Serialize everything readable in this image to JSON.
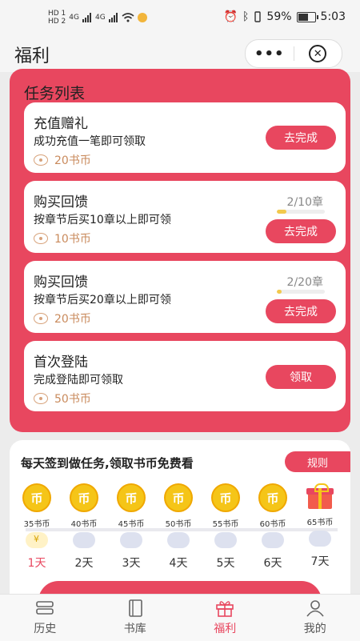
{
  "status_bar": {
    "sim1": "HD 1",
    "sim2": "HD 2",
    "net1": "4G",
    "net2": "4G",
    "battery": "59%",
    "time": "5:03"
  },
  "header": {
    "title": "福利",
    "menu_icon": "more-dots-icon",
    "close_icon": "close-circle-icon"
  },
  "tasks": {
    "title": "任务列表",
    "items": [
      {
        "name": "充值赠礼",
        "desc": "成功充值一笔即可领取",
        "reward": "20书币",
        "button": "去完成"
      },
      {
        "name": "购买回馈",
        "desc": "按章节后买10章以上即可领",
        "reward": "10书币",
        "progress_text": "2/10章",
        "progress": 0.2,
        "button": "去完成"
      },
      {
        "name": "购买回馈",
        "desc": "按章节后买20章以上即可领",
        "reward": "20书币",
        "progress_text": "2/20章",
        "progress": 0.1,
        "button": "去完成"
      },
      {
        "name": "首次登陆",
        "desc": "完成登陆即可领取",
        "reward": "50书币",
        "button": "领取"
      }
    ]
  },
  "signin": {
    "title": "每天签到做任务,领取书币免费看",
    "rules": "规则",
    "coin_glyph": "币",
    "days": [
      {
        "amount": "35书币",
        "label": "1天"
      },
      {
        "amount": "40书币",
        "label": "2天"
      },
      {
        "amount": "45书币",
        "label": "3天"
      },
      {
        "amount": "50书币",
        "label": "4天"
      },
      {
        "amount": "55书币",
        "label": "5天"
      },
      {
        "amount": "60书币",
        "label": "6天"
      },
      {
        "amount": "65书币",
        "label": "7天"
      }
    ]
  },
  "nav": {
    "items": [
      {
        "label": "历史",
        "icon": "history-icon"
      },
      {
        "label": "书库",
        "icon": "library-icon"
      },
      {
        "label": "福利",
        "icon": "gift-icon",
        "active": true
      },
      {
        "label": "我的",
        "icon": "user-icon"
      }
    ]
  },
  "colors": {
    "accent": "#e8475f",
    "coin": "#f5c518",
    "reward_text": "#c98a5c"
  }
}
